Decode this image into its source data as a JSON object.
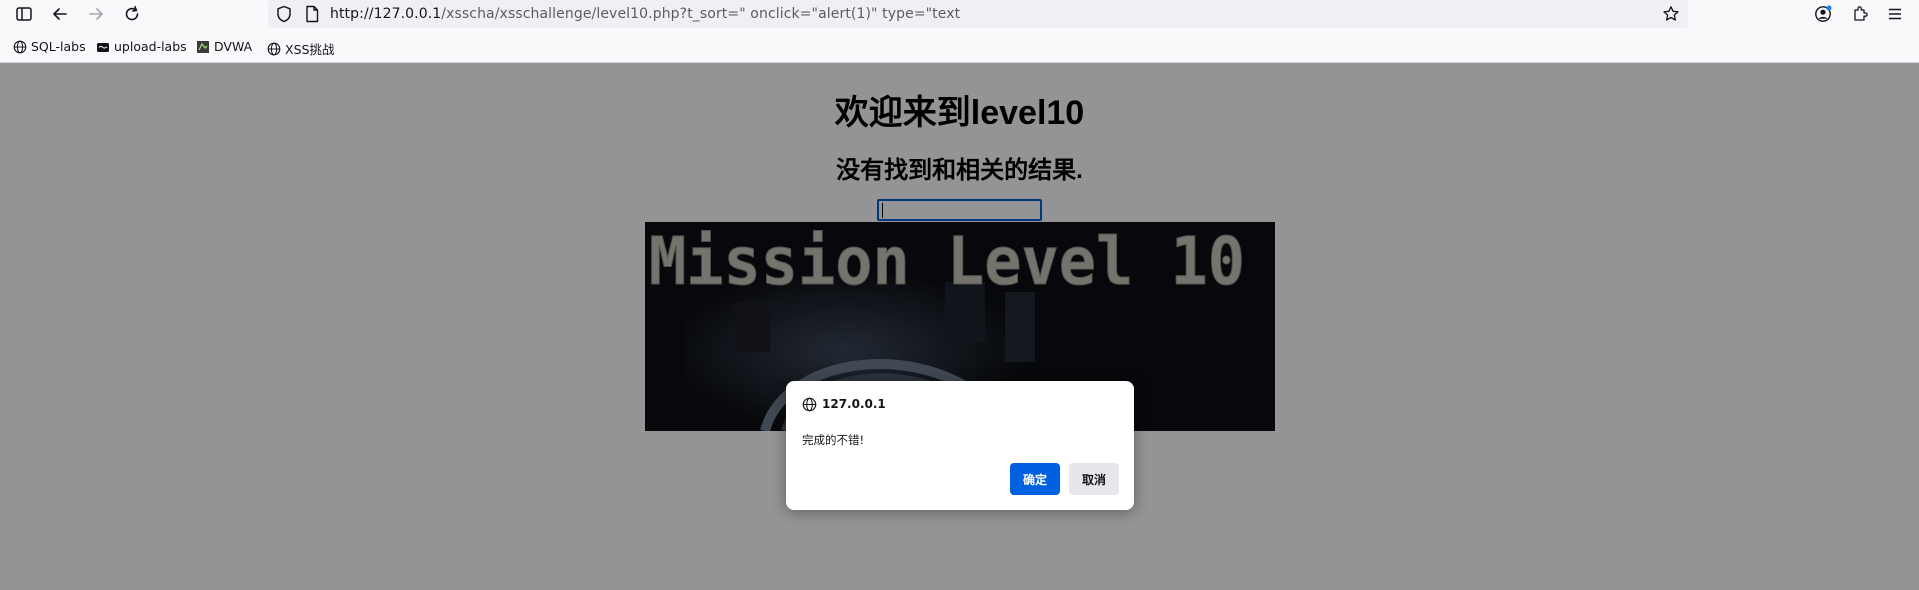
{
  "browser": {
    "url_host": "http://127.0.0.1",
    "url_path": "/xsscha/xsschallenge/level10.php?t_sort=\" onclick=\"alert(1)\" type=\"text",
    "bookmarks": [
      {
        "label": "SQL-labs",
        "icon": "globe-icon"
      },
      {
        "label": "upload-labs",
        "icon": "folder-icon"
      },
      {
        "label": "DVWA",
        "icon": "dvwa-favicon"
      },
      {
        "label": "XSS挑战",
        "icon": "globe-icon"
      }
    ]
  },
  "page": {
    "title": "欢迎来到level10",
    "subtitle": "没有找到和相关的结果.",
    "input_value": "",
    "banner_text": "Mission Level 10"
  },
  "dialog": {
    "origin": "127.0.0.1",
    "message": "完成的不错!",
    "ok_label": "确定",
    "cancel_label": "取消"
  },
  "colors": {
    "accent": "#0061e0",
    "overlay": "#979799",
    "focus_ring": "#0060df"
  }
}
